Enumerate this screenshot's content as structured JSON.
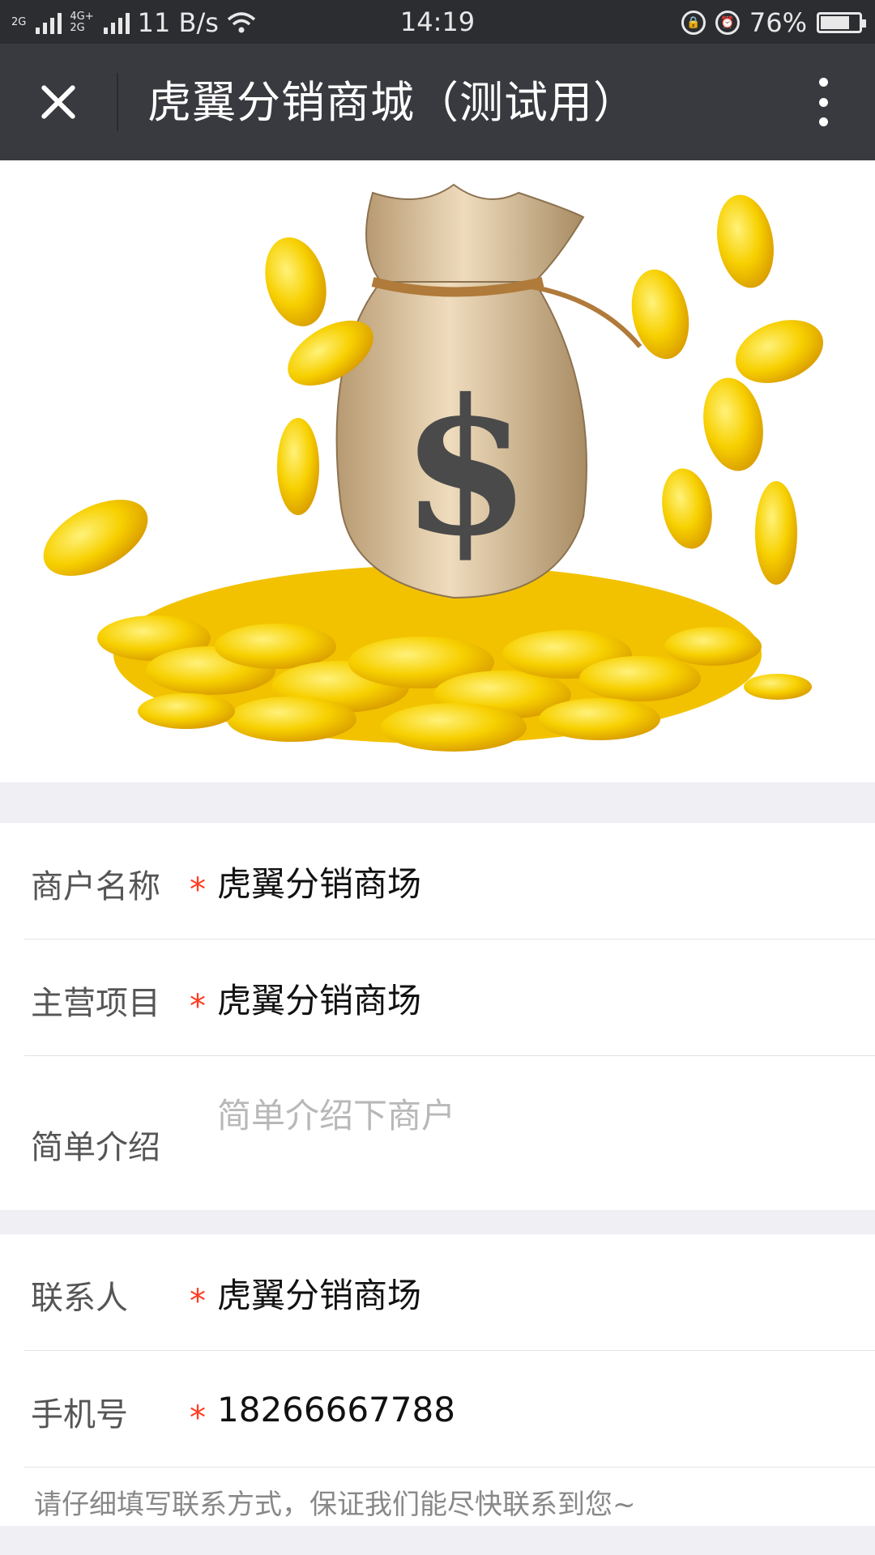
{
  "status_bar": {
    "net1": "2G",
    "net2_top": "4G+",
    "net2_bottom": "2G",
    "speed": "11 B/s",
    "time": "14:19",
    "battery": "76%",
    "battery_level": 0.76
  },
  "nav": {
    "title": "虎翼分销商城（测试用）"
  },
  "form": {
    "merchant_name": {
      "label": "商户名称",
      "required_mark": "*",
      "value": "虎翼分销商场"
    },
    "main_business": {
      "label": "主营项目",
      "required_mark": "*",
      "value": "虎翼分销商场"
    },
    "intro": {
      "label": "简单介绍",
      "placeholder": "简单介绍下商户"
    },
    "contact": {
      "label": "联系人",
      "required_mark": "*",
      "value": "虎翼分销商场"
    },
    "phone": {
      "label": "手机号",
      "required_mark": "*",
      "value": "18266667788"
    },
    "hint": "请仔细填写联系方式，保证我们能尽快联系到您~"
  },
  "banner": {
    "symbol": "$"
  },
  "colors": {
    "status_bar": "#2c2d31",
    "nav_bar": "#393a3f",
    "required": "#ff3b1f",
    "page_bg": "#efeff4",
    "gold": "#f5c800"
  }
}
